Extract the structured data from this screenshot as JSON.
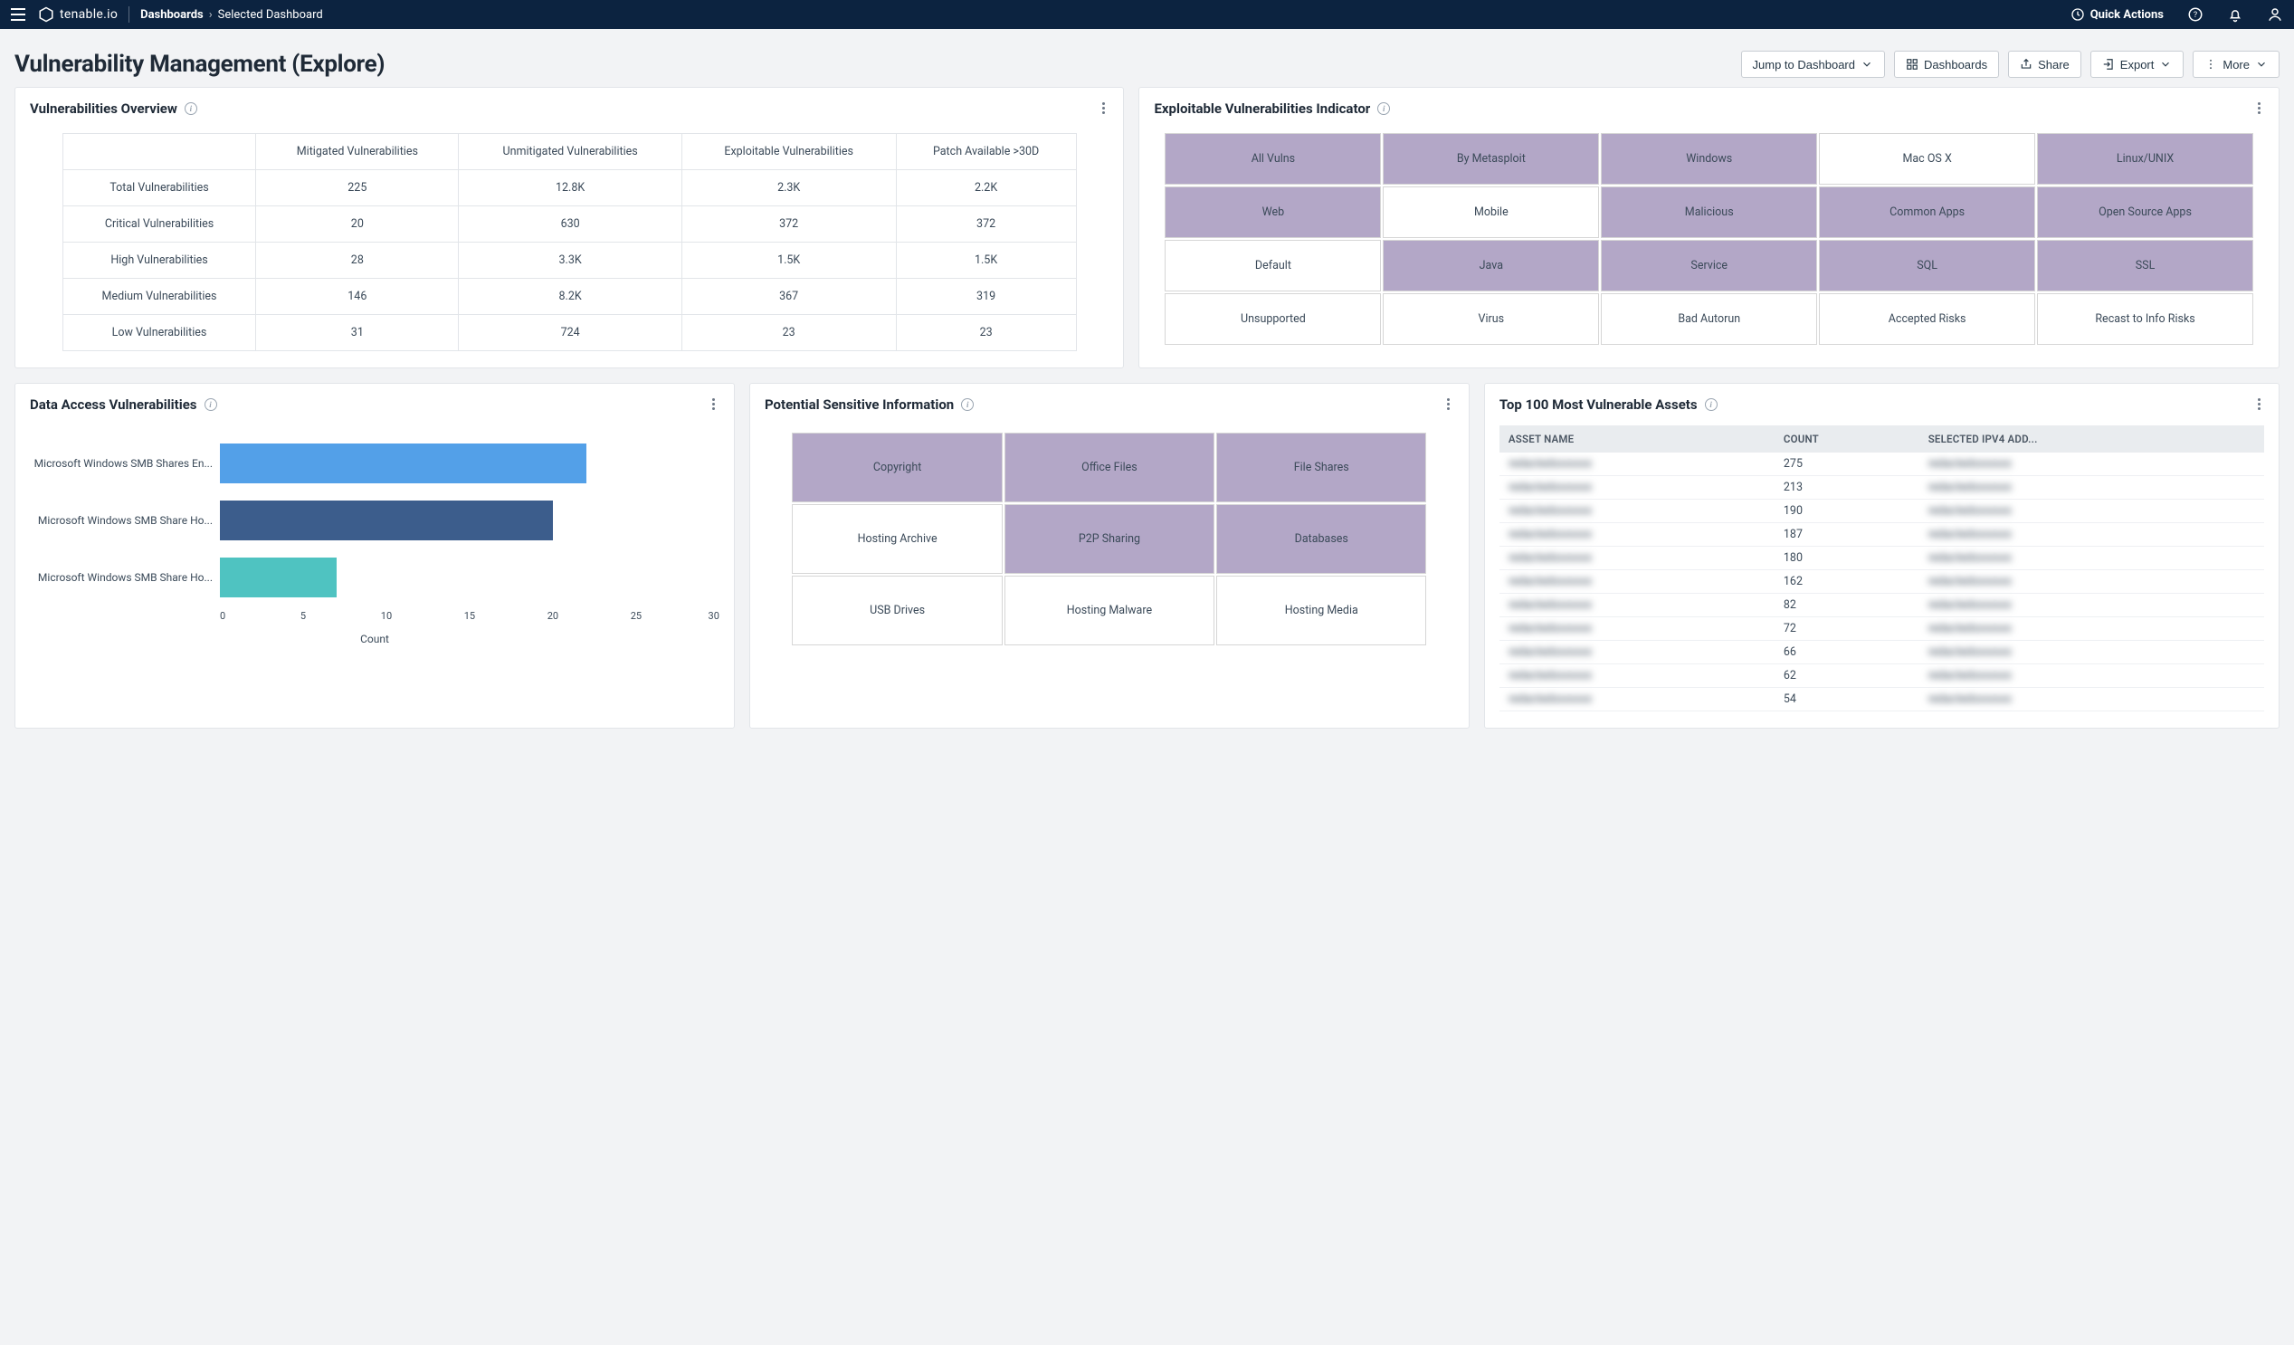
{
  "nav": {
    "brand": "tenable.io",
    "section": "Dashboards",
    "current": "Selected Dashboard",
    "quick_actions": "Quick Actions"
  },
  "page": {
    "title": "Vulnerability Management (Explore)"
  },
  "actions": {
    "jump": "Jump to Dashboard",
    "dashboards": "Dashboards",
    "share": "Share",
    "export": "Export",
    "more": "More"
  },
  "overview": {
    "title": "Vulnerabilities Overview",
    "columns": [
      "Mitigated Vulnerabilities",
      "Unmitigated Vulnerabilities",
      "Exploitable Vulnerabilities",
      "Patch Available >30D"
    ],
    "rows": [
      {
        "label": "Total Vulnerabilities",
        "cells": [
          "225",
          "12.8K",
          "2.3K",
          "2.2K"
        ]
      },
      {
        "label": "Critical Vulnerabilities",
        "cells": [
          "20",
          "630",
          "372",
          "372"
        ]
      },
      {
        "label": "High Vulnerabilities",
        "cells": [
          "28",
          "3.3K",
          "1.5K",
          "1.5K"
        ]
      },
      {
        "label": "Medium Vulnerabilities",
        "cells": [
          "146",
          "8.2K",
          "367",
          "319"
        ]
      },
      {
        "label": "Low Vulnerabilities",
        "cells": [
          "31",
          "724",
          "23",
          "23"
        ]
      }
    ]
  },
  "indicators": {
    "title": "Exploitable Vulnerabilities Indicator",
    "cells": [
      {
        "label": "All Vulns",
        "active": true
      },
      {
        "label": "By Metasploit",
        "active": true
      },
      {
        "label": "Windows",
        "active": true
      },
      {
        "label": "Mac OS X",
        "active": false
      },
      {
        "label": "Linux/UNIX",
        "active": true
      },
      {
        "label": "Web",
        "active": true
      },
      {
        "label": "Mobile",
        "active": false
      },
      {
        "label": "Malicious",
        "active": true
      },
      {
        "label": "Common Apps",
        "active": true
      },
      {
        "label": "Open Source Apps",
        "active": true
      },
      {
        "label": "Default",
        "active": false
      },
      {
        "label": "Java",
        "active": true
      },
      {
        "label": "Service",
        "active": true
      },
      {
        "label": "SQL",
        "active": true
      },
      {
        "label": "SSL",
        "active": true
      },
      {
        "label": "Unsupported",
        "active": false
      },
      {
        "label": "Virus",
        "active": false
      },
      {
        "label": "Bad Autorun",
        "active": false
      },
      {
        "label": "Accepted Risks",
        "active": false
      },
      {
        "label": "Recast to Info Risks",
        "active": false
      }
    ]
  },
  "dav": {
    "title": "Data Access Vulnerabilities",
    "xlabel": "Count"
  },
  "psi": {
    "title": "Potential Sensitive Information",
    "cells": [
      {
        "label": "Copyright",
        "active": true
      },
      {
        "label": "Office Files",
        "active": true
      },
      {
        "label": "File Shares",
        "active": true
      },
      {
        "label": "Hosting Archive",
        "active": false
      },
      {
        "label": "P2P Sharing",
        "active": true
      },
      {
        "label": "Databases",
        "active": true
      },
      {
        "label": "USB Drives",
        "active": false
      },
      {
        "label": "Hosting Malware",
        "active": false
      },
      {
        "label": "Hosting Media",
        "active": false
      }
    ]
  },
  "top100": {
    "title": "Top 100 Most Vulnerable Assets",
    "columns": [
      "ASSET NAME",
      "COUNT",
      "SELECTED IPV4 ADD..."
    ],
    "rows": [
      {
        "name": "redacted",
        "count": "275",
        "ip": "redacted"
      },
      {
        "name": "redacted",
        "count": "213",
        "ip": "redacted"
      },
      {
        "name": "redacted",
        "count": "190",
        "ip": "redacted"
      },
      {
        "name": "redacted",
        "count": "187",
        "ip": "redacted"
      },
      {
        "name": "redacted",
        "count": "180",
        "ip": "redacted"
      },
      {
        "name": "redacted",
        "count": "162",
        "ip": "redacted"
      },
      {
        "name": "redacted",
        "count": "82",
        "ip": "redacted"
      },
      {
        "name": "redacted",
        "count": "72",
        "ip": "redacted"
      },
      {
        "name": "redacted",
        "count": "66",
        "ip": "redacted"
      },
      {
        "name": "redacted",
        "count": "62",
        "ip": "redacted"
      },
      {
        "name": "redacted",
        "count": "54",
        "ip": "redacted"
      }
    ]
  },
  "chart_data": {
    "type": "bar",
    "orientation": "horizontal",
    "categories": [
      "Microsoft Windows SMB Shares En...",
      "Microsoft Windows SMB Share Ho...",
      "Microsoft Windows SMB Share Ho..."
    ],
    "values": [
      22,
      20,
      7
    ],
    "colors": [
      "#53a0e8",
      "#3c5d8c",
      "#4fc3c1"
    ],
    "xlabel": "Count",
    "ylabel": "",
    "xlim": [
      0,
      30
    ],
    "xticks": [
      0,
      5,
      10,
      15,
      20,
      25,
      30
    ],
    "title": "Data Access Vulnerabilities"
  }
}
